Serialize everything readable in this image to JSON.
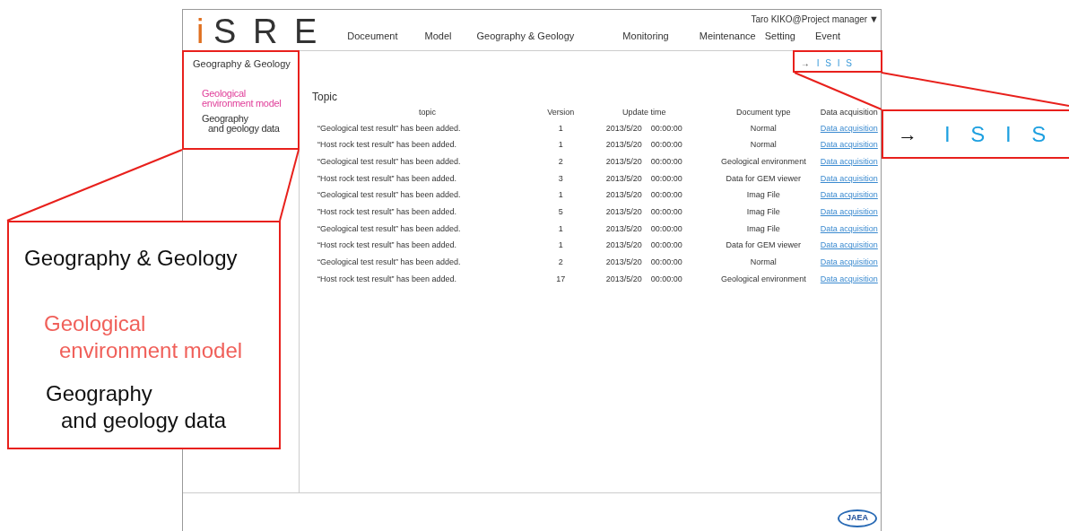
{
  "header": {
    "logo": {
      "initial": "i",
      "rest": "S R E"
    },
    "user_menu": "Taro KIKO@Project manager",
    "user_menu_caret": "▼",
    "nav": [
      {
        "label": "Doceument",
        "selected": false
      },
      {
        "label": "Model",
        "selected": false
      },
      {
        "label": "Geography & Geology",
        "selected": false
      },
      {
        "label": "Monitoring",
        "selected": false
      },
      {
        "label": "Meintenance",
        "selected": false
      },
      {
        "label": "Setting",
        "selected": false
      },
      {
        "label": "Event",
        "selected": false
      }
    ]
  },
  "sidebar": {
    "title": "Geography & Geology",
    "items": [
      {
        "lines": [
          "Geological",
          "environment model"
        ],
        "selected": true
      },
      {
        "lines": [
          "Geography",
          "and geology data"
        ],
        "selected": false
      }
    ]
  },
  "isis_link": {
    "arrow": "→",
    "label": "I S I S"
  },
  "topic": {
    "title": "Topic",
    "columns": [
      "topic",
      "Version",
      "Update time",
      "Document type",
      "Data acquisition"
    ],
    "rows": [
      {
        "topic": "“Geological test result” has been added.",
        "version": "1",
        "date": "2013/5/20",
        "time": "00:00:00",
        "type": "Normal",
        "link": "Data acquisition"
      },
      {
        "topic": "“Host rock test result” has been added.",
        "version": "1",
        "date": "2013/5/20",
        "time": "00:00:00",
        "type": "Normal",
        "link": "Data acquisition"
      },
      {
        "topic": "“Geological test result” has been added.",
        "version": "2",
        "date": "2013/5/20",
        "time": "00:00:00",
        "type": "Geological environment",
        "link": "Data acquisition"
      },
      {
        "topic": "”Host rock test result” has been added.",
        "version": "3",
        "date": "2013/5/20",
        "time": "00:00:00",
        "type": "Data for GEM viewer",
        "link": "Data acquisition"
      },
      {
        "topic": "“Geological test result” has been added.",
        "version": "1",
        "date": "2013/5/20",
        "time": "00:00:00",
        "type": "Imag File",
        "link": "Data acquisition"
      },
      {
        "topic": "”Host rock test result” has been added.",
        "version": "5",
        "date": "2013/5/20",
        "time": "00:00:00",
        "type": "Imag File",
        "link": "Data acquisition"
      },
      {
        "topic": "“Geological test result” has been added.",
        "version": "1",
        "date": "2013/5/20",
        "time": "00:00:00",
        "type": "Imag File",
        "link": "Data acquisition"
      },
      {
        "topic": "“Host rock test result” has been added.",
        "version": "1",
        "date": "2013/5/20",
        "time": "00:00:00",
        "type": "Data for GEM viewer",
        "link": "Data acquisition"
      },
      {
        "topic": "“Geological test result” has been added.",
        "version": "2",
        "date": "2013/5/20",
        "time": "00:00:00",
        "type": "Normal",
        "link": "Data acquisition"
      },
      {
        "topic": "“Host rock test result” has been added.",
        "version": "17",
        "date": "2013/5/20",
        "time": "00:00:00",
        "type": "Geological environment",
        "link": "Data acquisition"
      }
    ]
  },
  "footer": {
    "logo": "JAEA"
  },
  "callouts": {
    "sidebar": {
      "title": "Geography & Geology",
      "items": [
        {
          "lines": [
            "Geological",
            "environment model"
          ],
          "selected": true
        },
        {
          "lines": [
            "Geography",
            "and geology data"
          ],
          "selected": false
        }
      ]
    },
    "isis": {
      "arrow": "→",
      "label": "I S I S"
    }
  }
}
